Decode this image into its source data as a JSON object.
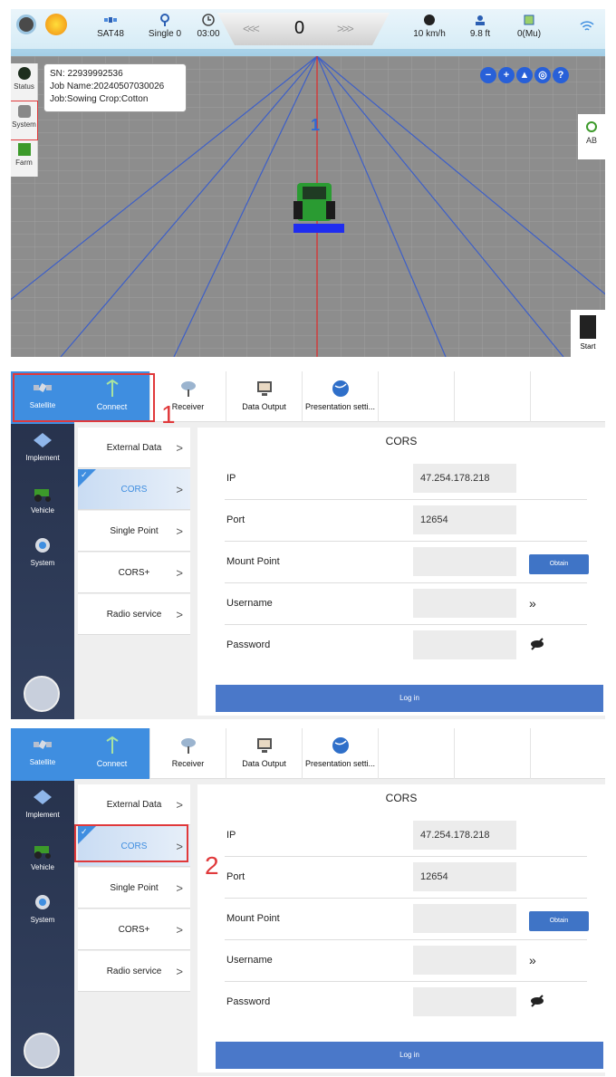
{
  "guidance": {
    "top_bar": {
      "sat_label": "SAT48",
      "fix_label": "Single 0",
      "timer_label": "03:00",
      "left_arrows": "<<<",
      "offset_value": "0",
      "right_arrows": ">>>",
      "speed_label": "10 km/h",
      "height_label": "9.8 ft",
      "area_label": "0(Mu)"
    },
    "left_dock": {
      "status_label": "Status",
      "system_label": "System",
      "farm_label": "Farm"
    },
    "info": {
      "sn": "SN: 22939992536",
      "job_name": "Job Name:20240507030026",
      "job_crop": "Job:Sowing  Crop:Cotton"
    },
    "line_number": "1",
    "ab_label": "AB",
    "start_label": "Start"
  },
  "settings": {
    "side_items": [
      {
        "label": "Satellite"
      },
      {
        "label": "Implement"
      },
      {
        "label": "Vehicle"
      },
      {
        "label": "System"
      }
    ],
    "tabs": [
      {
        "label": "Connect"
      },
      {
        "label": "Receiver"
      },
      {
        "label": "Data Output"
      },
      {
        "label": "Presentation setti..."
      }
    ],
    "submenu": [
      {
        "label": "External Data"
      },
      {
        "label": "CORS"
      },
      {
        "label": "Single Point"
      },
      {
        "label": "CORS+"
      },
      {
        "label": "Radio service"
      }
    ],
    "form": {
      "title": "CORS",
      "ip_label": "IP",
      "ip_value": "47.254.178.218",
      "port_label": "Port",
      "port_value": "12654",
      "mount_label": "Mount Point",
      "mount_value": "",
      "obtain_label": "Obtain",
      "user_label": "Username",
      "user_value": "",
      "pass_label": "Password",
      "pass_value": "",
      "login_label": "Log in"
    }
  },
  "steps": {
    "step1": "1",
    "step2": "2"
  },
  "colors": {
    "accent": "#3f8ee0",
    "highlight": "#e0393b",
    "sidebar": "#2a3550"
  }
}
